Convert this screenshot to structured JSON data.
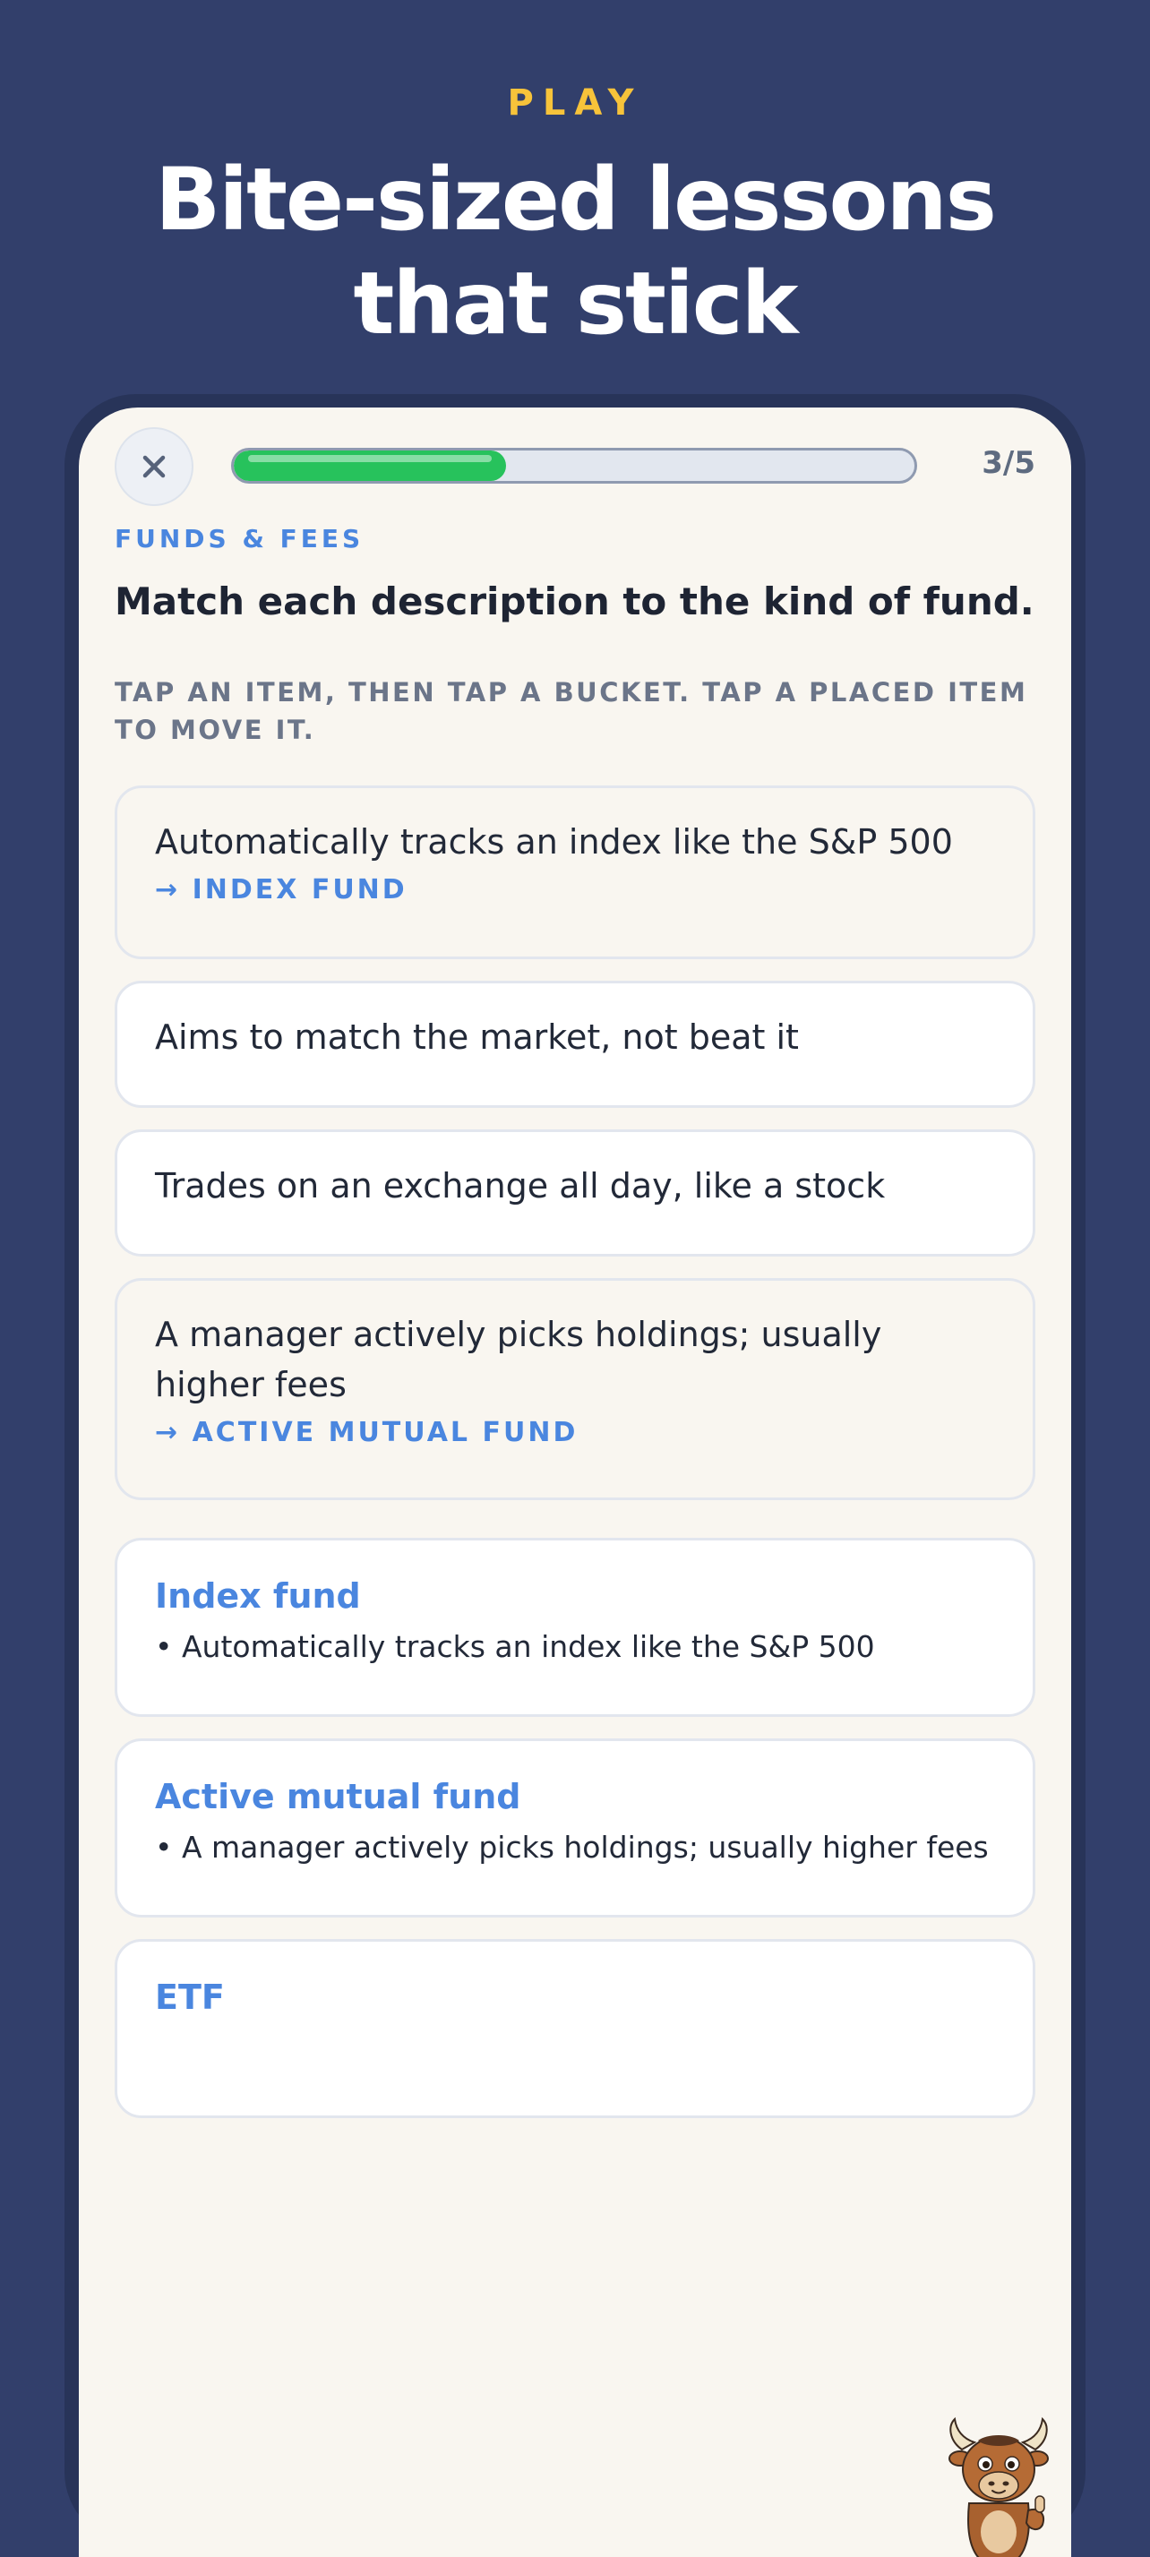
{
  "hero": {
    "eyebrow": "PLAY",
    "title_line1": "Bite-sized lessons",
    "title_line2": "that stick"
  },
  "quiz": {
    "close_icon": "close-icon",
    "progress": {
      "current": 3,
      "total": 5,
      "fraction": 0.4,
      "label": "3/5",
      "color": "#27c25c"
    },
    "category": "FUNDS & FEES",
    "question": "Match each description to the kind of fund.",
    "instructions": "TAP AN ITEM, THEN TAP A BUCKET. TAP A PLACED ITEM TO MOVE IT.",
    "items": [
      {
        "text": "Automatically tracks an index like the S&P 500",
        "assigned": "→ INDEX FUND"
      },
      {
        "text": "Aims to match the market, not beat it",
        "assigned": ""
      },
      {
        "text": "Trades on an exchange all day, like a stock",
        "assigned": ""
      },
      {
        "text": "A manager actively picks holdings; usually higher fees",
        "assigned": "→ ACTIVE MUTUAL FUND"
      }
    ],
    "buckets": [
      {
        "title": "Index fund",
        "items": [
          "• Automatically tracks an index like the S&P 500"
        ]
      },
      {
        "title": "Active mutual fund",
        "items": [
          "• A manager actively picks holdings; usually higher fees"
        ]
      },
      {
        "title": "ETF",
        "items": []
      }
    ],
    "mascot_icon": "bull-mascot-icon"
  },
  "colors": {
    "background": "#323f6b",
    "accent_yellow": "#f7c33a",
    "accent_blue": "#4a86df",
    "progress_green": "#27c25c",
    "screen_bg": "#f9f6f0"
  }
}
